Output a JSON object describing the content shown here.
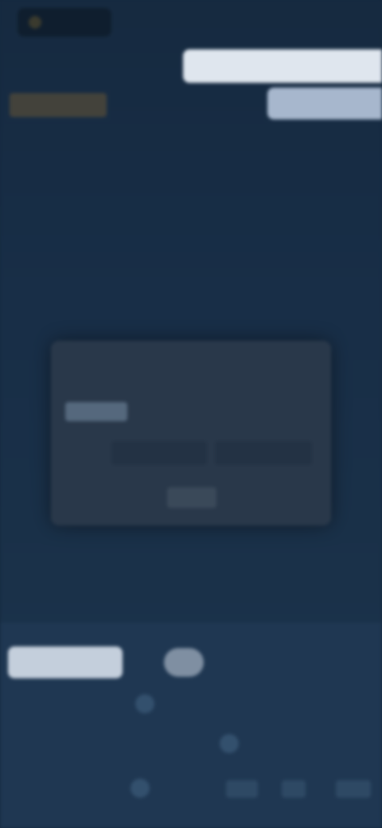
{
  "header": {
    "logo_text": "",
    "meta_text": "",
    "sub_text": "",
    "link_label": "",
    "promo_title": "",
    "promo_subtitle": ""
  },
  "dialog": {
    "title": "",
    "badge_label": "",
    "row_text": "",
    "field_label": "",
    "field_value_1": "",
    "field_value_2": "",
    "button_label": ""
  },
  "bottom": {
    "active_tab_label": "",
    "pill_label": "",
    "tab_2_label": "",
    "tab_3_label": "",
    "row1_col1": "",
    "row1_col2": "",
    "row2_col1": "",
    "row2_col2": "",
    "row3_col1": "",
    "row3_chip1": "",
    "row3_chip2": "",
    "row3_chip3": ""
  },
  "colors": {
    "background": "#15293f",
    "panel": "#1f3752",
    "dialog": "#29384a",
    "accent_gold": "#b39a6b",
    "light_text_box": "#dfe6ee"
  }
}
